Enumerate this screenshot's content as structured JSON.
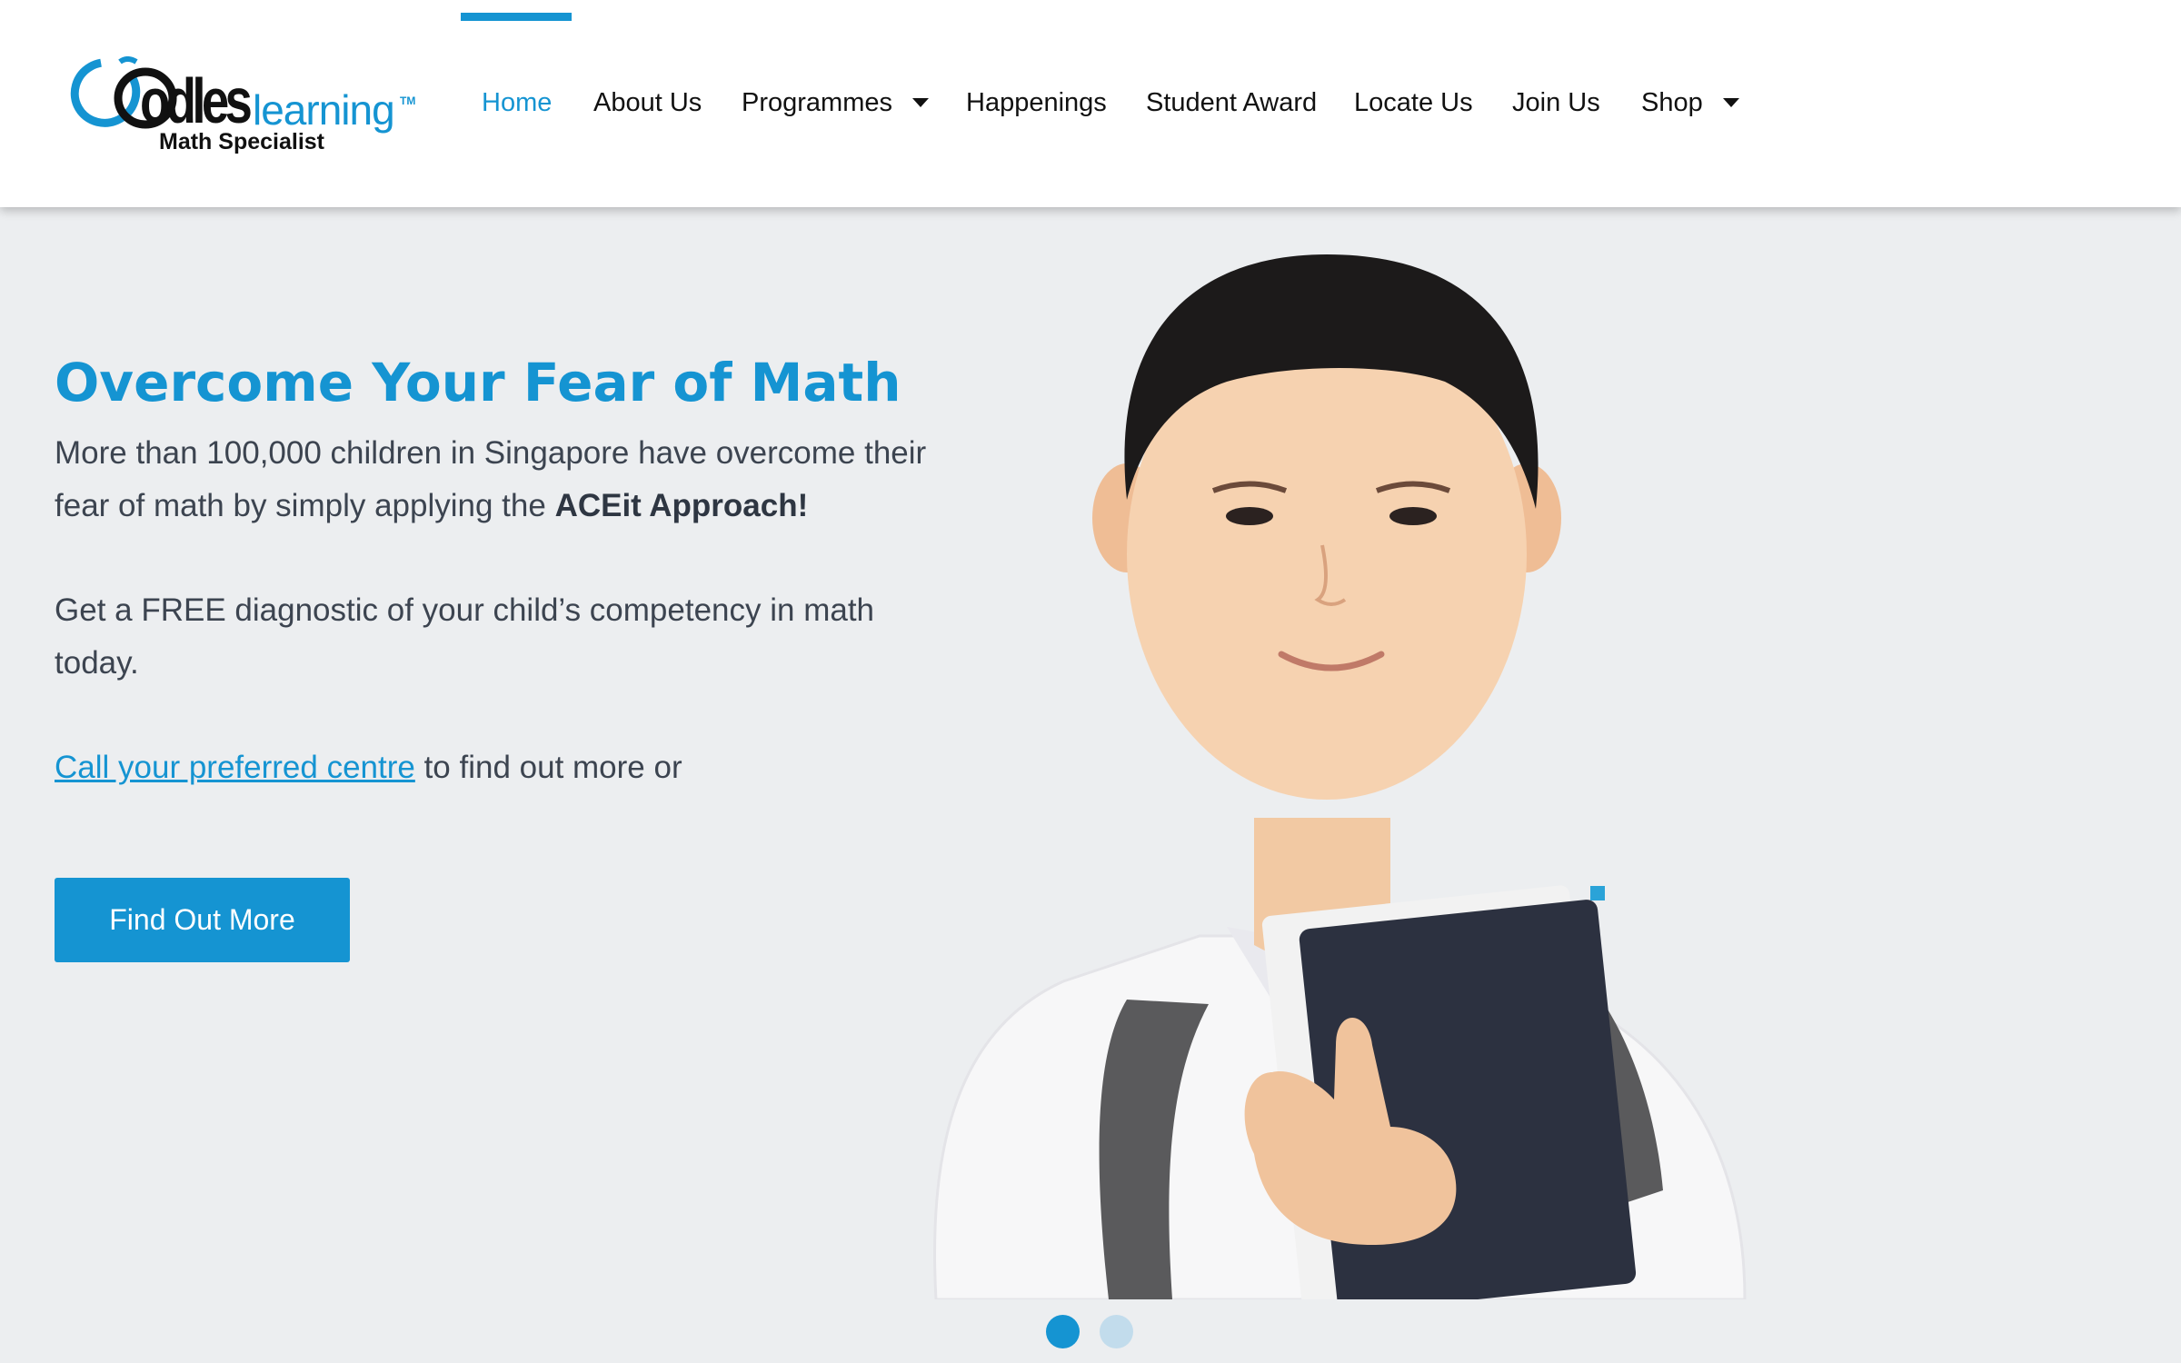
{
  "brand": {
    "logo_word": "odles",
    "logo_learning": "learning",
    "logo_tm": "TM",
    "tagline": "Math Specialist"
  },
  "nav": {
    "items": [
      {
        "label": "Home",
        "active": true,
        "dropdown": false
      },
      {
        "label": "About Us",
        "active": false,
        "dropdown": false
      },
      {
        "label": "Programmes",
        "active": false,
        "dropdown": true
      },
      {
        "label": "Happenings",
        "active": false,
        "dropdown": false
      },
      {
        "label": "Student Award",
        "active": false,
        "dropdown": false
      },
      {
        "label": "Locate Us",
        "active": false,
        "dropdown": false
      },
      {
        "label": "Join Us",
        "active": false,
        "dropdown": false
      },
      {
        "label": "Shop",
        "active": false,
        "dropdown": true
      }
    ]
  },
  "hero": {
    "title": "Overcome Your Fear of Math",
    "p1_text": "More than 100,000 children in Singapore have overcome their fear of math by simply applying the ",
    "p1_bold": "ACEit Approach!",
    "p2_text": "Get a FREE diagnostic of your child’s competency in math today.",
    "p3_link": "Call your preferred centre",
    "p3_text": " to find out more or",
    "cta_label": "Find Out More"
  },
  "slider": {
    "slide_count": 2,
    "active_index": 0
  },
  "colors": {
    "accent": "#1594d2",
    "hero_bg": "#eceef0",
    "text": "#3c4450"
  },
  "icons": {
    "dropdown": "caret-down-icon",
    "logo": "oodles-logo"
  }
}
